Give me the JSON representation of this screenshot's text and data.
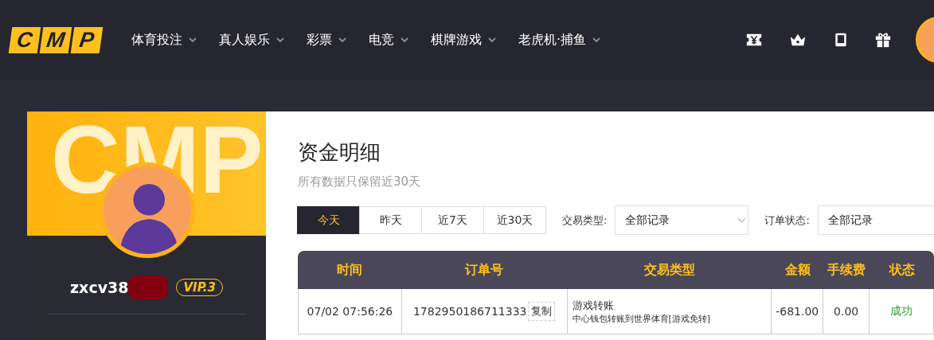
{
  "logo": {
    "letters": [
      "C",
      "M",
      "P"
    ]
  },
  "nav": [
    {
      "label": "体育投注"
    },
    {
      "label": "真人娱乐"
    },
    {
      "label": "彩票"
    },
    {
      "label": "电竞"
    },
    {
      "label": "棋牌游戏"
    },
    {
      "label": "老虎机·捕鱼"
    }
  ],
  "profile": {
    "banner_text": "CMP",
    "username": "zxcv38",
    "vip": "VIP.3"
  },
  "page": {
    "title": "资金明细",
    "subtitle": "所有数据只保留近30天"
  },
  "date_tabs": [
    {
      "label": "今天",
      "selected": true
    },
    {
      "label": "昨天",
      "selected": false
    },
    {
      "label": "近7天",
      "selected": false
    },
    {
      "label": "近30天",
      "selected": false
    }
  ],
  "filters": [
    {
      "label": "交易类型:",
      "value": "全部记录"
    },
    {
      "label": "订单状态:",
      "value": "全部记录"
    }
  ],
  "table": {
    "columns": [
      "时间",
      "订单号",
      "交易类型",
      "金额",
      "手续费",
      "状态"
    ],
    "rows": [
      {
        "time": "07/02 07:56:26",
        "order": "1782950186711333",
        "copy": "复制",
        "type": "游戏转账",
        "detail": "中心钱包转账到世界体育[游戏免转]",
        "amount": "-681.00",
        "fee": "0.00",
        "status": "成功"
      }
    ]
  }
}
